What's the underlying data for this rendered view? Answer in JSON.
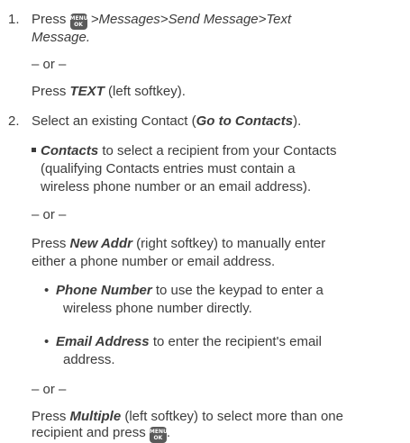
{
  "step1": {
    "number": "1.",
    "press": "Press",
    "menu_key_top": "MENU",
    "menu_key_bottom": "OK",
    "path": ">Messages>Send Message>Text",
    "path_cont": "Message.",
    "or1": "– or –",
    "press2": "Press",
    "text_key": "TEXT",
    "press2_suffix": "(left softkey)."
  },
  "step2": {
    "number": "2.",
    "text": "Select an existing Contact (",
    "go_to_contacts": "Go to Contacts",
    "text_end": ").",
    "contacts_em": "Contacts",
    "contacts_desc_1": "to select a recipient from your Contacts",
    "contacts_desc_2": "(qualifying Contacts entries must contain a",
    "contacts_desc_3": "wireless phone number or an email address).",
    "or2": "– or –",
    "press3": "Press",
    "new_addr": "New Addr",
    "new_addr_desc_1": "(right softkey) to manually enter",
    "new_addr_desc_2": "either a phone number or email address.",
    "phone_number": "Phone Number",
    "phone_desc_1": "to use the keypad to enter a",
    "phone_desc_2": "wireless phone number directly.",
    "email_address": "Email Address",
    "email_desc_1": "to enter the recipient's email",
    "email_desc_2": "address.",
    "or3": "– or –",
    "press4": "Press",
    "multiple": "Multiple",
    "multiple_desc_1": "(left softkey) to select more than one",
    "multiple_desc_2": "recipient and press",
    "multiple_end": "."
  }
}
